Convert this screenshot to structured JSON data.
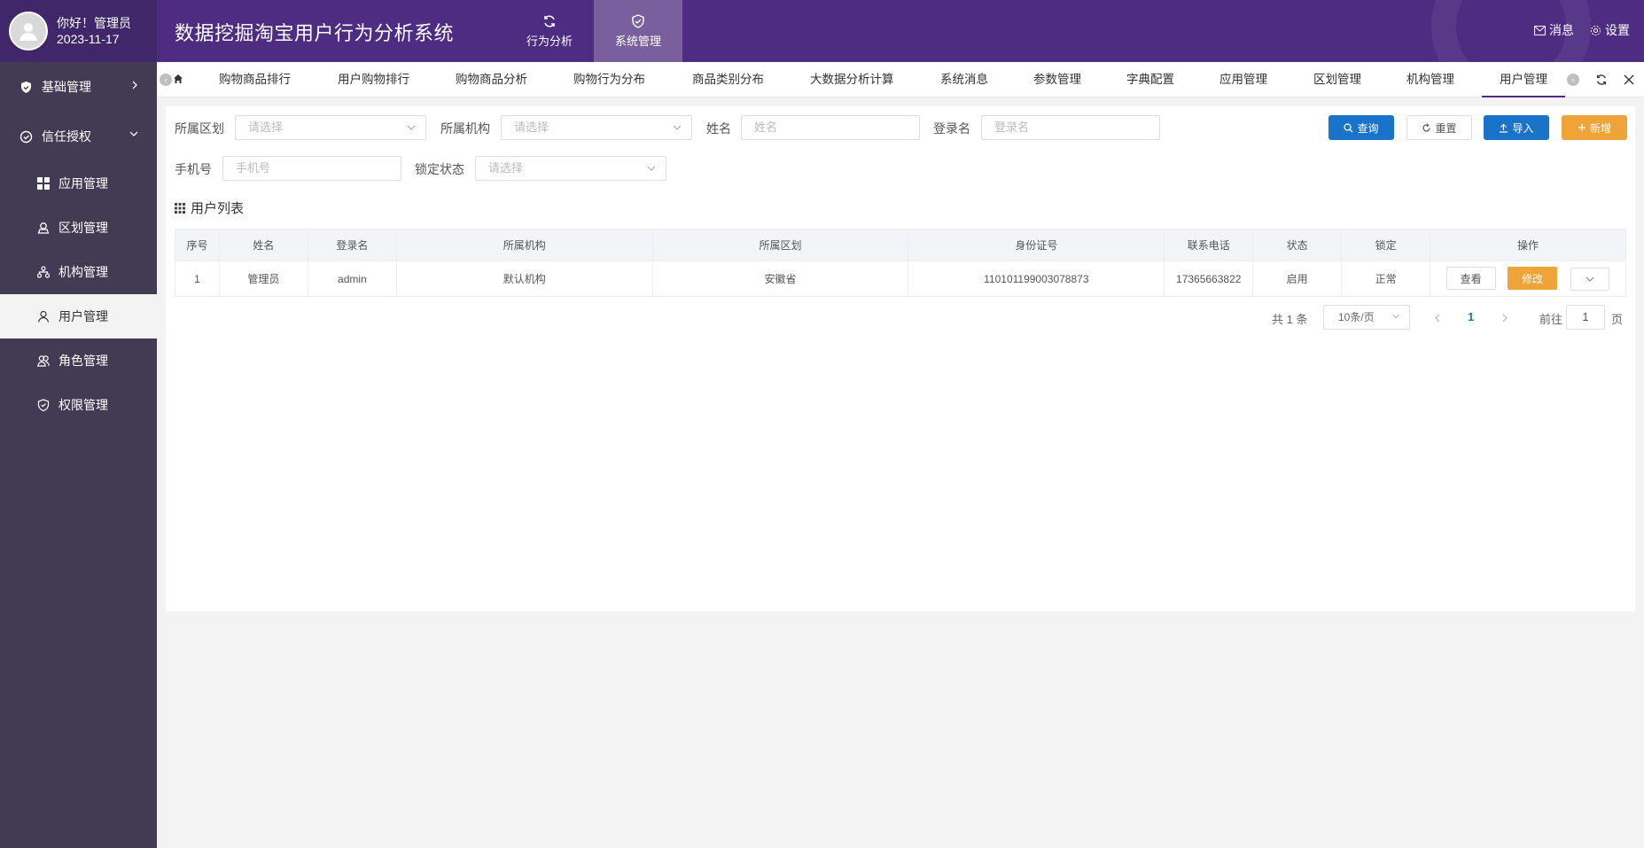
{
  "header": {
    "greeting": "你好！管理员",
    "date": "2023-11-17",
    "title": "数据挖掘淘宝用户行为分析系统",
    "nav": [
      {
        "label": "行为分析",
        "icon": "refresh-icon"
      },
      {
        "label": "系统管理",
        "icon": "shield-check-icon",
        "active": true
      }
    ],
    "messages": "消息",
    "settings": "设置"
  },
  "sidebar": {
    "groups": [
      {
        "label": "基础管理",
        "icon": "shield-icon",
        "expanded": false
      },
      {
        "label": "信任授权",
        "icon": "check-circle-icon",
        "expanded": true
      }
    ],
    "items": [
      {
        "label": "应用管理",
        "icon": "grid-icon"
      },
      {
        "label": "区划管理",
        "icon": "location-icon"
      },
      {
        "label": "机构管理",
        "icon": "org-icon"
      },
      {
        "label": "用户管理",
        "icon": "user-icon",
        "active": true
      },
      {
        "label": "角色管理",
        "icon": "users-icon"
      },
      {
        "label": "权限管理",
        "icon": "shield-check-icon"
      }
    ]
  },
  "tabs": [
    "购物商品排行",
    "用户购物排行",
    "购物商品分析",
    "购物行为分布",
    "商品类别分布",
    "大数据分析计算",
    "系统消息",
    "参数管理",
    "字典配置",
    "应用管理",
    "区划管理",
    "机构管理",
    "用户管理"
  ],
  "active_tab": "用户管理",
  "filters": {
    "region_label": "所属区划",
    "region_placeholder": "请选择",
    "org_label": "所属机构",
    "org_placeholder": "请选择",
    "name_label": "姓名",
    "name_placeholder": "姓名",
    "login_label": "登录名",
    "login_placeholder": "登录名",
    "phone_label": "手机号",
    "phone_placeholder": "手机号",
    "lock_label": "锁定状态",
    "lock_placeholder": "请选择"
  },
  "actions": {
    "query": "查询",
    "reset": "重置",
    "import": "导入",
    "add": "新增"
  },
  "list_title": "用户列表",
  "table": {
    "columns": [
      "序号",
      "姓名",
      "登录名",
      "所属机构",
      "所属区划",
      "身份证号",
      "联系电话",
      "状态",
      "锁定",
      "操作"
    ],
    "rows": [
      {
        "no": "1",
        "name": "管理员",
        "login": "admin",
        "org": "默认机构",
        "region": "安徽省",
        "id_card": "110101199003078873",
        "phone": "17365663822",
        "status": "启用",
        "lock": "正常"
      }
    ],
    "view": "查看",
    "edit": "修改"
  },
  "pagination": {
    "total": "共 1 条",
    "page_size": "10条/页",
    "current": "1",
    "goto": "前往",
    "goto_value": "1",
    "page_suffix": "页"
  },
  "colors": {
    "header": "#4d2c82",
    "sidebar": "#433b53",
    "primary": "#1873c9",
    "warning": "#efa43a"
  }
}
